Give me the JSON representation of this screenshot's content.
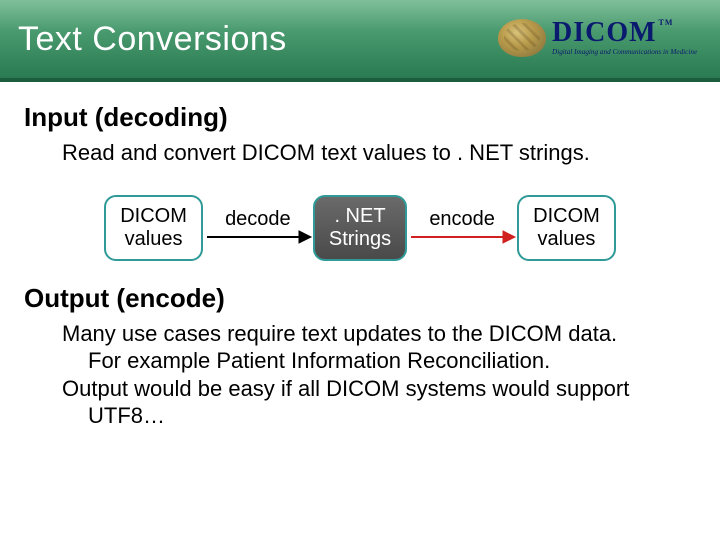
{
  "title": "Text Conversions",
  "logo": {
    "brand": "DICOM",
    "tm": "TM",
    "tagline": "Digital Imaging and Communications in Medicine"
  },
  "input": {
    "heading": "Input (decoding)",
    "text": "Read and convert DICOM text values to . NET strings."
  },
  "diagram": {
    "node1_line1": "DICOM",
    "node1_line2": "values",
    "edge1": "decode",
    "node2_line1": ". NET",
    "node2_line2": "Strings",
    "edge2": "encode",
    "node3_line1": "DICOM",
    "node3_line2": "values"
  },
  "output": {
    "heading": "Output (encode)",
    "line1": "Many use cases require text updates to the DICOM data.",
    "line2": "For example Patient Information Reconciliation.",
    "line3": "Output would be easy if all DICOM systems would support",
    "line4": "UTF8…"
  }
}
